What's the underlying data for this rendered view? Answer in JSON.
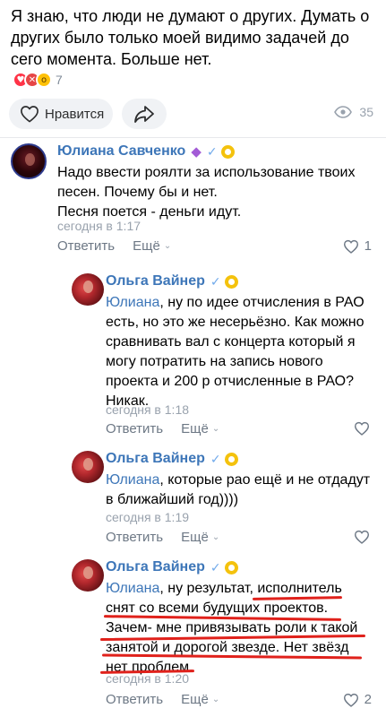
{
  "post": {
    "text": "Я знаю, что люди не думают о других. Думать о других было только моей видимо задачей до сего момента. Больше нет.",
    "reactions_count": "7",
    "like_label": "Нравится",
    "views": "35",
    "colors": {
      "accent": "#3d76b8",
      "underline": "#e0211b"
    }
  },
  "comments": [
    {
      "author": "Юлиана Савченко",
      "text": "Надо ввести роялти за использование твоих песен. Почему бы и нет.\nПесня поется - деньги идут.",
      "time": "сегодня в 1:17",
      "reply_label": "Ответить",
      "more_label": "Ещё",
      "likes": "1"
    },
    {
      "author": "Ольга Вайнер",
      "mention": "Юлиана",
      "text": ", ну по идее отчисления в РАО есть, но это же несерьёзно. Как можно сравнивать вал с концерта который я могу потратить на запись нового проекта и 200 р отчисленные в РАО? Никак.",
      "time": "сегодня в 1:18",
      "reply_label": "Ответить",
      "more_label": "Ещё",
      "likes": ""
    },
    {
      "author": "Ольга Вайнер",
      "mention": "Юлиана",
      "text": ", которые рао ещё и не отдадут в ближайший год))))",
      "time": "сегодня в 1:19",
      "reply_label": "Ответить",
      "more_label": "Ещё",
      "likes": ""
    },
    {
      "author": "Ольга Вайнер",
      "mention": "Юлиана",
      "text": ", ну результат, исполнитель снят со всеми будущих проектов. Зачем- мне привязывать роли к такой занятой и дорогой звезде. Нет звёзд нет проблем.",
      "time": "сегодня в 1:20",
      "reply_label": "Ответить",
      "more_label": "Ещё",
      "likes": "2"
    }
  ]
}
